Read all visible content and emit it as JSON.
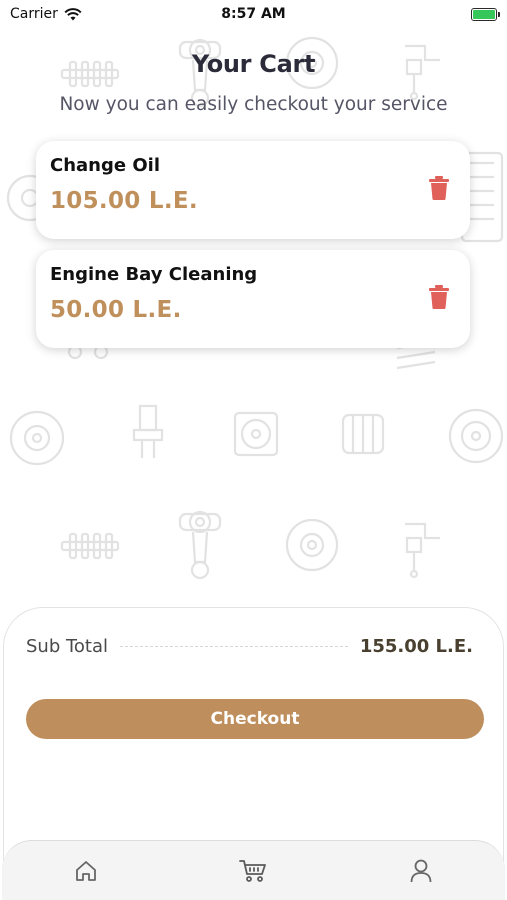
{
  "status_bar": {
    "carrier": "Carrier",
    "time": "8:57 AM",
    "battery_level": 1.0,
    "battery_color": "#35c759"
  },
  "header": {
    "title": "Your Cart",
    "subtitle": "Now you can easily checkout your service"
  },
  "cart": {
    "items": [
      {
        "name": "Change Oil",
        "price": "105.00 L.E.",
        "delete_icon": "trash-icon"
      },
      {
        "name": "Engine Bay Cleaning",
        "price": "50.00 L.E.",
        "delete_icon": "trash-icon"
      }
    ]
  },
  "summary": {
    "subtotal_label": "Sub Total",
    "subtotal_value": "155.00 L.E.",
    "checkout_label": "Checkout"
  },
  "tab_bar": {
    "tabs": [
      {
        "icon": "home-icon",
        "active": false
      },
      {
        "icon": "cart-icon",
        "active": true
      },
      {
        "icon": "profile-icon",
        "active": false
      }
    ]
  },
  "colors": {
    "accent": "#bf8e5d",
    "price": "#c0905c",
    "delete": "#e0605a"
  }
}
